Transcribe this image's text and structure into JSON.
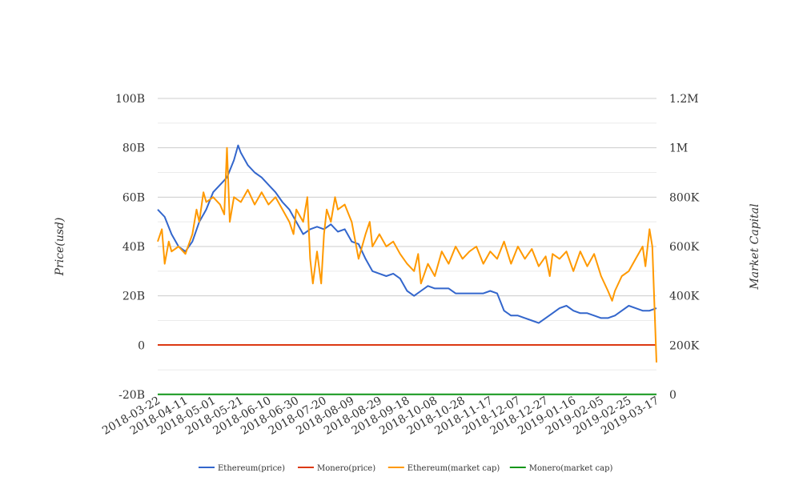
{
  "chart_data": {
    "type": "line",
    "x_start": "2018-03-22",
    "x_days": 360,
    "xticks": [
      "2018-03-22",
      "2018-04-11",
      "2018-05-01",
      "2018-05-21",
      "2018-06-10",
      "2018-06-30",
      "2018-07-20",
      "2018-08-09",
      "2018-08-29",
      "2018-09-18",
      "2018-10-08",
      "2018-10-28",
      "2018-11-17",
      "2018-12-07",
      "2018-12-27",
      "2019-01-16",
      "2019-02-05",
      "2019-02-25",
      "2019-03-17"
    ],
    "ylabel": "Price(usd)",
    "y2label": "Market Capital",
    "ylim": [
      -20000000000,
      100000000000
    ],
    "y2lim": [
      0,
      1200000
    ],
    "yticks": [
      {
        "v": -20,
        "label": "-20B"
      },
      {
        "v": 0,
        "label": "0"
      },
      {
        "v": 20,
        "label": "20B"
      },
      {
        "v": 40,
        "label": "40B"
      },
      {
        "v": 60,
        "label": "60B"
      },
      {
        "v": 80,
        "label": "80B"
      },
      {
        "v": 100,
        "label": "100B"
      }
    ],
    "y2ticks": [
      {
        "v": 0,
        "label": "0"
      },
      {
        "v": 200,
        "label": "200K"
      },
      {
        "v": 400,
        "label": "400K"
      },
      {
        "v": 600,
        "label": "600K"
      },
      {
        "v": 800,
        "label": "800K"
      },
      {
        "v": 1000,
        "label": "1M"
      },
      {
        "v": 1200,
        "label": "1.2M"
      }
    ],
    "grid": true,
    "legend_position": "bottom",
    "series": [
      {
        "name": "Ethereum(price)",
        "axis": "left",
        "unit": "B",
        "color": "#3366cc",
        "days": [
          0,
          5,
          10,
          15,
          20,
          25,
          30,
          35,
          40,
          45,
          50,
          55,
          58,
          60,
          65,
          70,
          75,
          80,
          85,
          90,
          95,
          100,
          105,
          110,
          115,
          120,
          125,
          130,
          135,
          140,
          145,
          150,
          155,
          160,
          165,
          170,
          175,
          180,
          185,
          190,
          195,
          200,
          205,
          210,
          215,
          220,
          225,
          230,
          235,
          240,
          245,
          250,
          255,
          260,
          265,
          270,
          275,
          280,
          285,
          290,
          295,
          300,
          305,
          310,
          315,
          320,
          325,
          330,
          335,
          340,
          345,
          350,
          355,
          360
        ],
        "values": [
          55,
          52,
          45,
          40,
          38,
          42,
          50,
          55,
          62,
          65,
          68,
          75,
          81,
          78,
          73,
          70,
          68,
          65,
          62,
          58,
          55,
          50,
          45,
          47,
          48,
          47,
          49,
          46,
          47,
          42,
          41,
          35,
          30,
          29,
          28,
          29,
          27,
          22,
          20,
          22,
          24,
          23,
          23,
          23,
          21,
          21,
          21,
          21,
          21,
          22,
          21,
          14,
          12,
          12,
          11,
          10,
          9,
          11,
          13,
          15,
          16,
          14,
          13,
          13,
          12,
          11,
          11,
          12,
          14,
          16,
          15,
          14,
          14,
          15
        ]
      },
      {
        "name": "Monero(price)",
        "axis": "left",
        "unit": "B",
        "color": "#dc3912",
        "days": [
          0,
          360
        ],
        "values": [
          0.1,
          0.1
        ]
      },
      {
        "name": "Ethereum(market cap)",
        "axis": "right",
        "unit": "K",
        "color": "#ff9900",
        "days": [
          0,
          3,
          5,
          8,
          10,
          15,
          20,
          25,
          28,
          30,
          33,
          35,
          40,
          45,
          48,
          50,
          52,
          55,
          60,
          65,
          70,
          75,
          80,
          85,
          90,
          95,
          98,
          100,
          105,
          108,
          110,
          112,
          115,
          118,
          120,
          122,
          125,
          128,
          130,
          135,
          140,
          145,
          150,
          153,
          155,
          160,
          165,
          170,
          175,
          180,
          185,
          188,
          190,
          195,
          200,
          205,
          210,
          215,
          220,
          225,
          230,
          235,
          240,
          245,
          250,
          255,
          260,
          265,
          270,
          275,
          280,
          283,
          285,
          290,
          295,
          300,
          305,
          310,
          315,
          320,
          325,
          328,
          330,
          335,
          340,
          345,
          350,
          352,
          355,
          357,
          360
        ],
        "values": [
          620,
          670,
          530,
          620,
          580,
          600,
          570,
          650,
          750,
          700,
          820,
          780,
          800,
          770,
          730,
          1000,
          700,
          800,
          780,
          830,
          770,
          820,
          770,
          800,
          750,
          700,
          650,
          750,
          700,
          800,
          550,
          450,
          580,
          450,
          650,
          750,
          700,
          800,
          750,
          770,
          700,
          550,
          650,
          700,
          600,
          650,
          600,
          620,
          570,
          530,
          500,
          570,
          450,
          530,
          480,
          580,
          530,
          600,
          550,
          580,
          600,
          530,
          580,
          550,
          620,
          530,
          600,
          550,
          590,
          520,
          560,
          480,
          570,
          550,
          580,
          500,
          580,
          520,
          570,
          480,
          420,
          380,
          420,
          480,
          500,
          550,
          600,
          520,
          670,
          600,
          130
        ]
      },
      {
        "name": "Monero(market cap)",
        "axis": "right",
        "unit": "K",
        "color": "#109618",
        "days": [
          0,
          360
        ],
        "values": [
          0.5,
          0.5
        ]
      }
    ]
  }
}
